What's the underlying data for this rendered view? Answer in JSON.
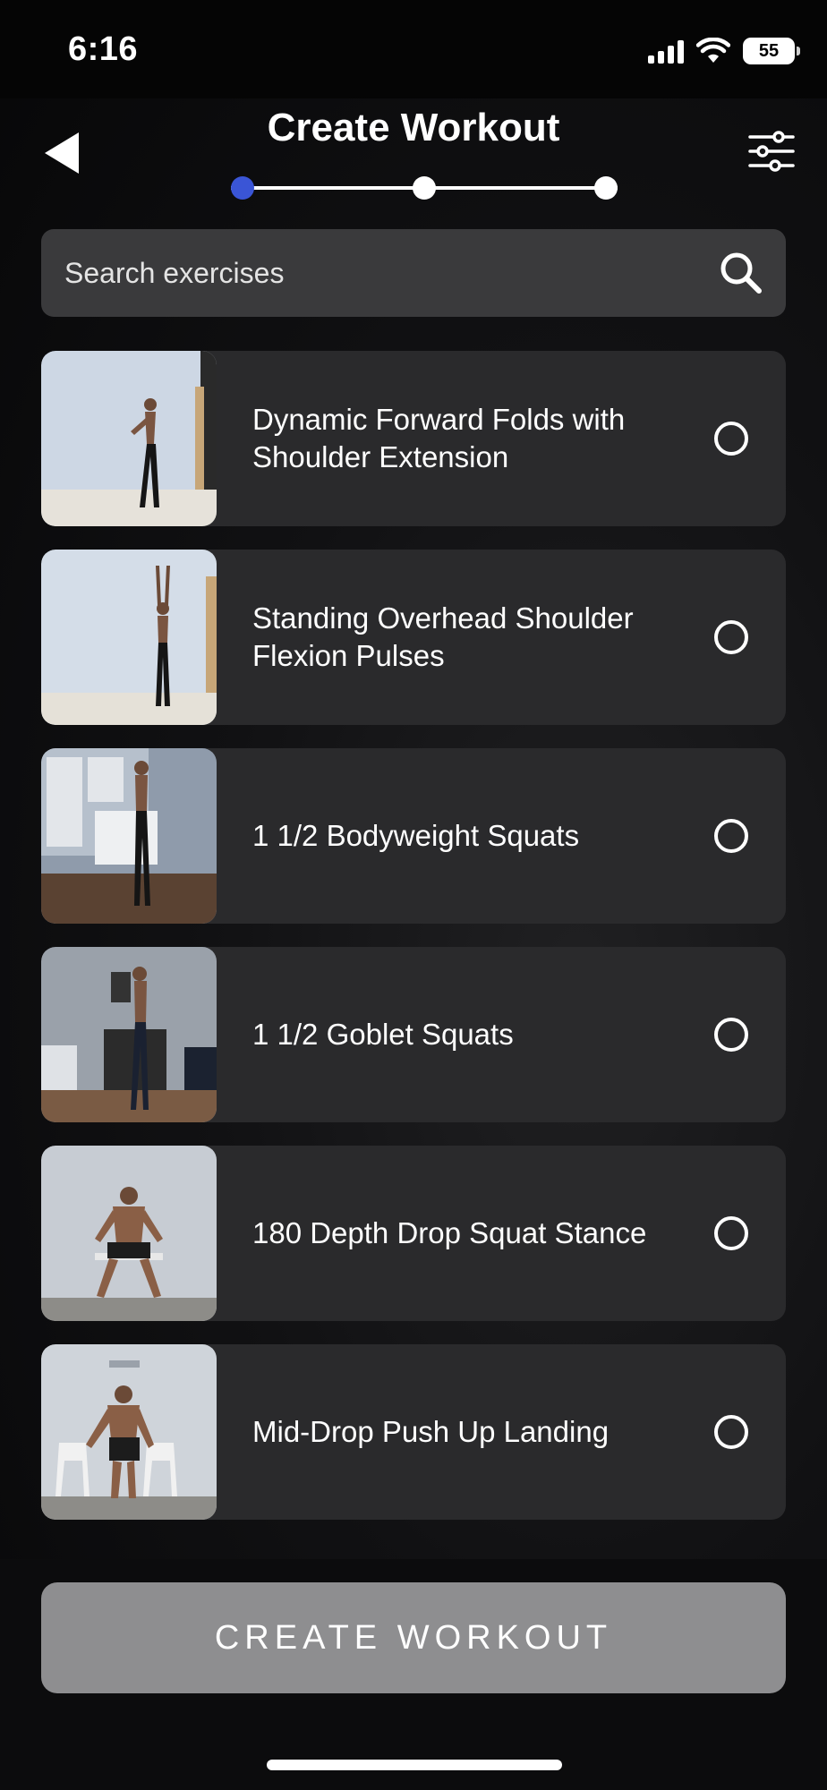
{
  "status_bar": {
    "time": "6:16",
    "battery": "55"
  },
  "header": {
    "title": "Create Workout",
    "back_icon": "back-triangle-icon",
    "filter_icon": "sliders-filter-icon",
    "steps_total": 3,
    "current_step": 1,
    "active_color": "#3a55d6"
  },
  "search": {
    "placeholder": "Search exercises",
    "value": "",
    "icon": "search-icon"
  },
  "exercises": [
    {
      "name": "Dynamic Forward Folds with Shoulder Extension",
      "selected": false
    },
    {
      "name": "Standing Overhead Shoulder Flexion Pulses",
      "selected": false
    },
    {
      "name": "1 1/2 Bodyweight Squats",
      "selected": false
    },
    {
      "name": "1 1/2 Goblet Squats",
      "selected": false
    },
    {
      "name": "180 Depth Drop Squat Stance",
      "selected": false
    },
    {
      "name": "Mid-Drop Push Up Landing",
      "selected": false
    }
  ],
  "footer": {
    "create_label": "CREATE WORKOUT"
  }
}
